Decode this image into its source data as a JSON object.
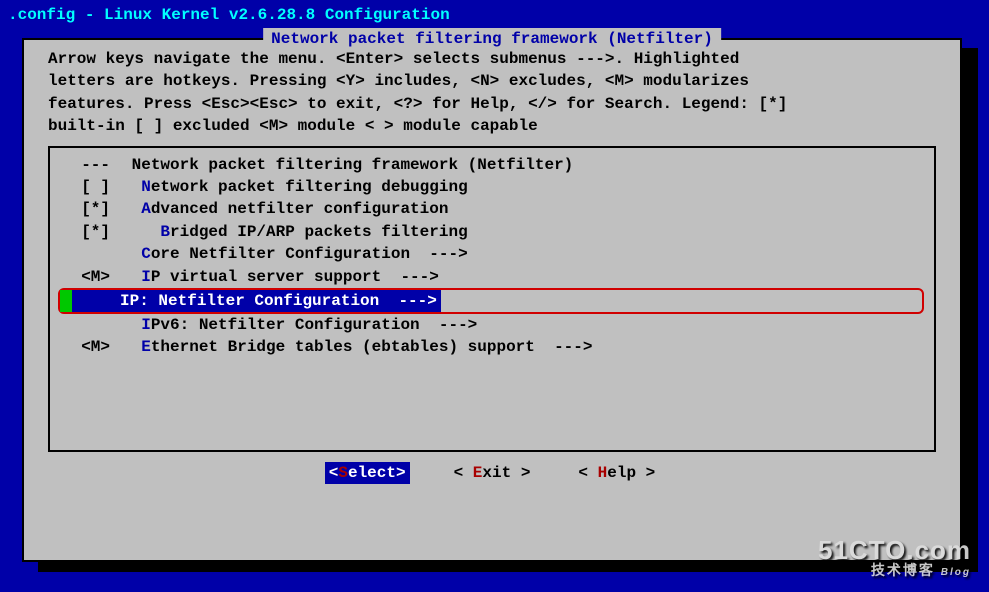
{
  "title": ".config - Linux Kernel v2.6.28.8 Configuration",
  "box_title": "Network packet filtering framework (Netfilter)",
  "help_lines": [
    "Arrow keys navigate the menu.  <Enter> selects submenus --->.  Highlighted",
    "letters are hotkeys.  Pressing <Y> includes, <N> excludes, <M> modularizes",
    "features.  Press <Esc><Esc> to exit, <?> for Help, </> for Search.  Legend: [*]",
    "built-in  [ ] excluded  <M> module  < > module capable"
  ],
  "menu": [
    {
      "prefix": "---",
      "hot": "",
      "label": "Network packet filtering framework (Netfilter)",
      "arrow": ""
    },
    {
      "prefix": "[ ]",
      "hot": "N",
      "label": "etwork packet filtering debugging",
      "arrow": ""
    },
    {
      "prefix": "[*]",
      "hot": "A",
      "label": "dvanced netfilter configuration",
      "arrow": ""
    },
    {
      "prefix": "[*]",
      "hot": "B",
      "label": "ridged IP/ARP packets filtering",
      "arrow": "",
      "indent": true
    },
    {
      "prefix": "",
      "hot": "C",
      "label": "ore Netfilter Configuration  --->",
      "arrow": ""
    },
    {
      "prefix": "<M>",
      "hot": "I",
      "label": "P virtual server support  --->",
      "arrow": ""
    },
    {
      "prefix": "",
      "hot": "I",
      "label": "P: Netfilter Configuration  --->",
      "arrow": "",
      "selected": true
    },
    {
      "prefix": "",
      "hot": "I",
      "label": "Pv6: Netfilter Configuration  --->",
      "arrow": ""
    },
    {
      "prefix": "<M>",
      "hot": "E",
      "label": "thernet Bridge tables (ebtables) support  --->",
      "arrow": ""
    }
  ],
  "buttons": {
    "select": {
      "open": "<",
      "hot": "S",
      "rest": "elect",
      "close": ">"
    },
    "exit": {
      "open": "< ",
      "hot": "E",
      "rest": "xit",
      "close": " >"
    },
    "help": {
      "open": "< ",
      "hot": "H",
      "rest": "elp",
      "close": " >"
    }
  },
  "watermark": {
    "main": "51CTO.com",
    "sub": "技术博客",
    "tag": "Blog"
  }
}
